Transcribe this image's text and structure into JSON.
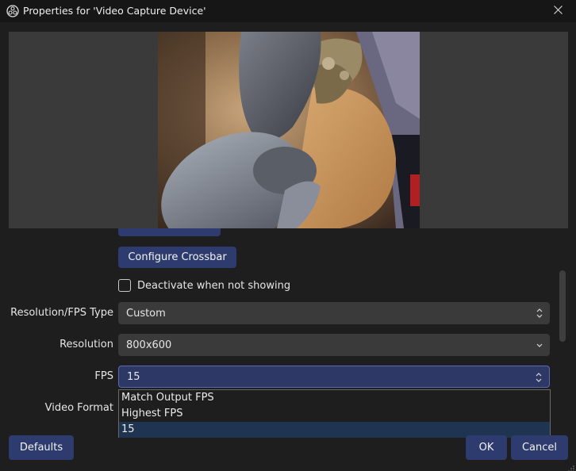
{
  "window": {
    "title": "Properties for 'Video Capture Device'",
    "icon": "obs-logo-icon",
    "close_icon": "close-icon"
  },
  "preview": {
    "description_icon": "camera-preview"
  },
  "form": {
    "partial_button_label": "",
    "configure_crossbar_label": "Configure Crossbar",
    "deactivate_checkbox_label": "Deactivate when not showing",
    "deactivate_checked": false,
    "resolution_fps_type": {
      "label": "Resolution/FPS Type",
      "value": "Custom"
    },
    "resolution": {
      "label": "Resolution",
      "value": "800x600"
    },
    "fps": {
      "label": "FPS",
      "value": "15"
    },
    "video_format": {
      "label": "Video Format"
    }
  },
  "fps_dropdown": {
    "options": [
      "Match Output FPS",
      "Highest FPS",
      "15"
    ],
    "selected_index": 2
  },
  "buttons": {
    "defaults": "Defaults",
    "ok": "OK",
    "cancel": "Cancel"
  },
  "colors": {
    "accent_button": "#2e3b6e",
    "window_bg": "#1e1e1e",
    "combo_bg": "#3a3a3a",
    "selected_item": "#1e3450"
  }
}
